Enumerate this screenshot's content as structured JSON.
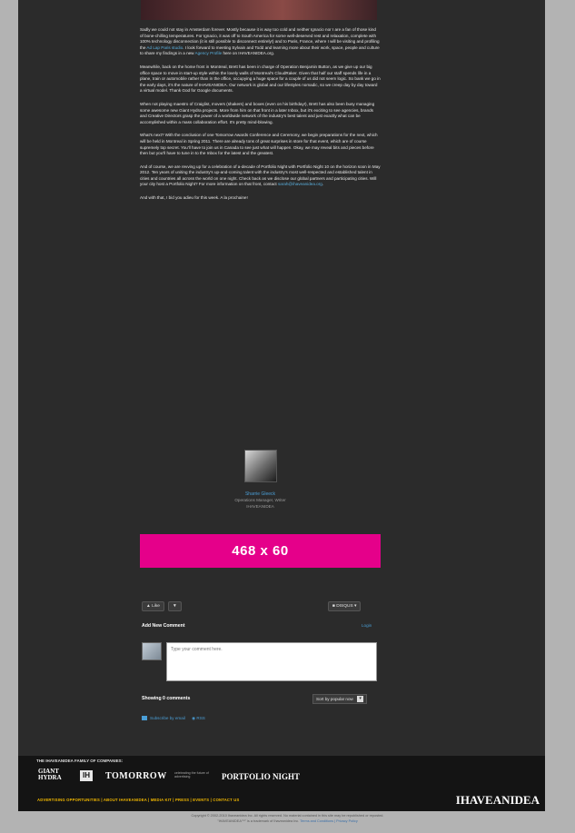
{
  "article": {
    "paragraphs": [
      "Sadly we could not stay in Amsterdam forever. Mostly because it is way too cold and neither Ignacio nor I are a fan of those kind of bone-chilling temperatures. For Ignacio, it was off to South America for some well-deserved rest and relaxation, complete with 100% technology disconnection (it is still possible to disconnect entirely!) and to Paris, France, where I will be visiting and profiling the",
      "Meanwhile, back on the home front in Montreal, Brett has been in charge of Operation Benjamin Button, as we give up our big office space to move in start-up style within the lovely walls of Montreal's CloudRaker. Given that half our staff spends life in a plane, train or automobile rather than in the office, occupying a huge space for a couple of us did not seem logic. So bank we go in the early days, it's the nature of IHAVEANIDEA. Our network is global and our lifestyles nomadic, so we creep day by day toward a virtual model. Thank God for Google documents.",
      "When not playing maestro of Craiglist, movers (shakers) and boxes (even on his birthday!), Brett has also been busy managing some awesome new Giant Hydra projects. More from him on that front in a later Inbox, but it's exciting to see agencies, brands and Creative Directors grasp the power of a worldwide network of the industry's best talent and just exactly what can be accomplished within a mass collaboration effort. It's pretty mind-blowing.",
      "What's next? With the conclusion of one Tomorrow Awards Conference and Ceremony, we begin preparations for the next, which will be held in Montreal in Spring 2011. There are already tons of great surprises in store for that event, which are of course supremely top secret. You'll have to join us in Canada to see just what will happen. Okay, we may reveal bits and pieces before then but you'll have to tune in to the Inbox for the latest and the greatest.",
      "And of course, we are revving up for a celebration of a-decade of Portfolio Night with Portfolio Night 10 on the horizon soon in May 2012. Ten years of uniting the industry's up-and-coming talent with the industry's most well-respected and established talent in cities and countries all across the world on one night. Check back as we disclose our global partners and participating cities. Will your city host a Portfolio Night? For more information on that front, contact",
      "And with that, I bid you adieu for this week. A la prochaine!"
    ],
    "link_1": "Ad Lap Paris studio",
    "p1_after": ". I look forward to meeting Sylvain and Todd and learning more about their work, space, people and culture to share my findings in a new",
    "link_2": "Agency Profile",
    "p1_end": "here on IHAVEANIDEA.org.",
    "link_3": "sarah@ihaveanidea.org",
    "p5_end": "."
  },
  "author": {
    "name": "Sharrie Gleeck",
    "title": "Operations Manager, Writer",
    "company": "IHAVEANIDEA"
  },
  "ad": {
    "label": "468 x 60"
  },
  "comments": {
    "like_label": "Like",
    "dislike_label": "",
    "disqus_label": "DISQUS",
    "add_title": "Add New Comment",
    "login_label": "Login",
    "input_placeholder": "Type your comment here.",
    "showing_label": "Showing 0 comments",
    "sort_label": "Sort by popular now",
    "subscribe_label": "Subscribe by email",
    "rss_label": "RSS"
  },
  "footer": {
    "family_title": "THE IHAVEANIDEA FAMILY OF COMPANIES:",
    "logo_giant": "GIANT",
    "logo_hydra": "HYDRA",
    "logo_badge": "IH",
    "logo_tomorrow": "TOMORROW",
    "logo_tomorrow_sub": "celebrating the future of advertising",
    "logo_portfolio": "PORTFOLIO NIGHT",
    "nav": "ADVERTISING OPPORTUNITIES  |  ABOUT IHAVEANIDEA  |  MEDIA KIT  |  PRESS  |  EVENTS  |  CONTACT US",
    "brand": "IHAVEANIDEA"
  },
  "copyright": {
    "line1": "Copyright © 2002-2010 Ihaveanidea Inc. All rights reserved. No material contained in this site may be republished or reposted.",
    "line2_pre": "\"IHAVEANIDEA™\" is a trademark of Ihaveanidea Inc.",
    "line2_link": "Terms and Conditions | Privacy Policy"
  }
}
